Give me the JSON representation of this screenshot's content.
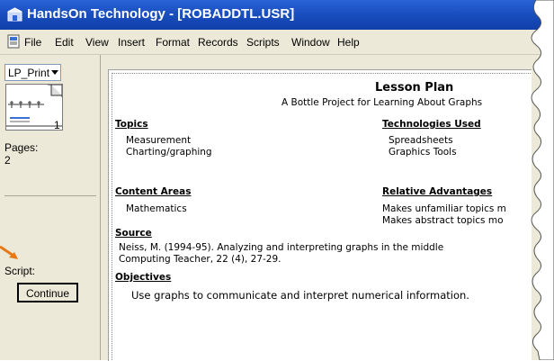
{
  "window": {
    "title": "HandsOn Technology - [ROBADDTL.USR]"
  },
  "menubar": {
    "items": [
      "File",
      "Edit",
      "View",
      "Insert",
      "Format",
      "Records",
      "Scripts",
      "Window",
      "Help"
    ]
  },
  "sidebar": {
    "layout_selected": "LP_Print",
    "thumb_number": "1",
    "pages_label": "Pages:",
    "pages_value": "2",
    "script_label": "Script:",
    "continue_label": "Continue"
  },
  "colors": {
    "titlebar": "#1a4fbf",
    "chrome": "#ece9d8",
    "pointer_arrow": "#e87814"
  },
  "lesson": {
    "title": "Lesson Plan",
    "subtitle": "A Bottle Project for Learning About Graphs",
    "topics_heading": "Topics",
    "topics": [
      "Measurement",
      "Charting/graphing"
    ],
    "tech_heading": "Technologies Used",
    "tech": [
      "Spreadsheets",
      "Graphics Tools"
    ],
    "content_heading": "Content Areas",
    "content": [
      "Mathematics"
    ],
    "advantages_heading": "Relative Advantages",
    "advantages": [
      "Makes unfamiliar topics m",
      "Makes abstract topics mo"
    ],
    "source_heading": "Source",
    "source_lines": [
      "Neiss, M. (1994-95). Analyzing and interpreting graphs in the middle",
      "Computing Teacher, 22 (4), 27-29."
    ],
    "objectives_heading": "Objectives",
    "objective": "Use graphs to communicate and interpret numerical information."
  }
}
